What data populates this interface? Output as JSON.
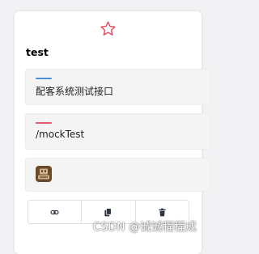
{
  "card": {
    "title": "test",
    "description": "配客系统测试接口",
    "path": "/mockTest"
  },
  "icons": {
    "favorite": "star-outline-icon",
    "service_icon": "robot-icon",
    "link": "link-icon",
    "copy": "copy-icon",
    "delete": "trash-icon"
  },
  "colors": {
    "description_accent": "#4a90d9",
    "path_accent": "#e05a6d",
    "favorite_star": "#e8475f",
    "action_icons": "#2c3440"
  },
  "watermark": "CSDN @诚诚程程成"
}
